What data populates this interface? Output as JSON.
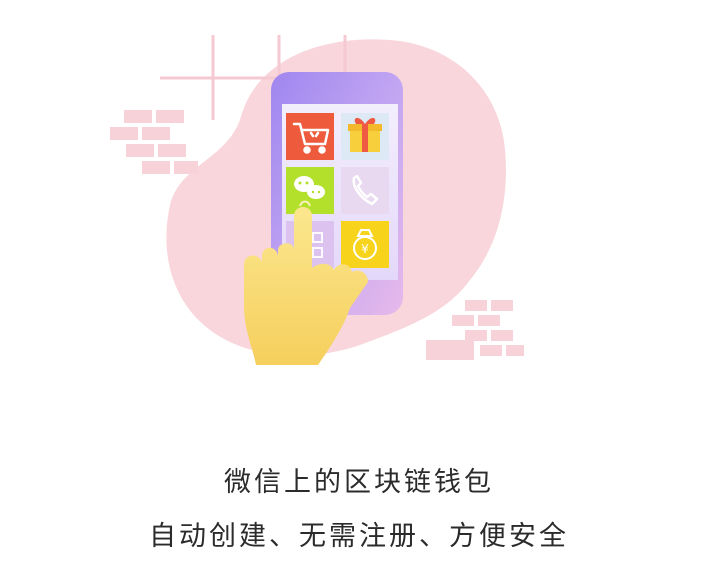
{
  "hero": {
    "title": "微信上的区块链钱包",
    "subtitle": "自动创建、无需注册、方便安全"
  },
  "phone": {
    "apps": [
      {
        "name": "shopping-cart-icon",
        "color": "#ee5a3c"
      },
      {
        "name": "gift-icon",
        "color": "#dde9f5"
      },
      {
        "name": "wechat-icon",
        "color": "#b3e02a"
      },
      {
        "name": "phone-call-icon",
        "color": "#e8d8f0"
      },
      {
        "name": "grid-icon",
        "color": "#dcc3ef"
      },
      {
        "name": "money-bag-icon",
        "color": "#f7d41b"
      }
    ],
    "money_symbol": "¥"
  },
  "colors": {
    "blob": "#f8d6dc",
    "brick": "#f7d2d8",
    "phone_body": "#b99ef1",
    "hand": "#fbe07a",
    "text": "#2b2b2b"
  }
}
